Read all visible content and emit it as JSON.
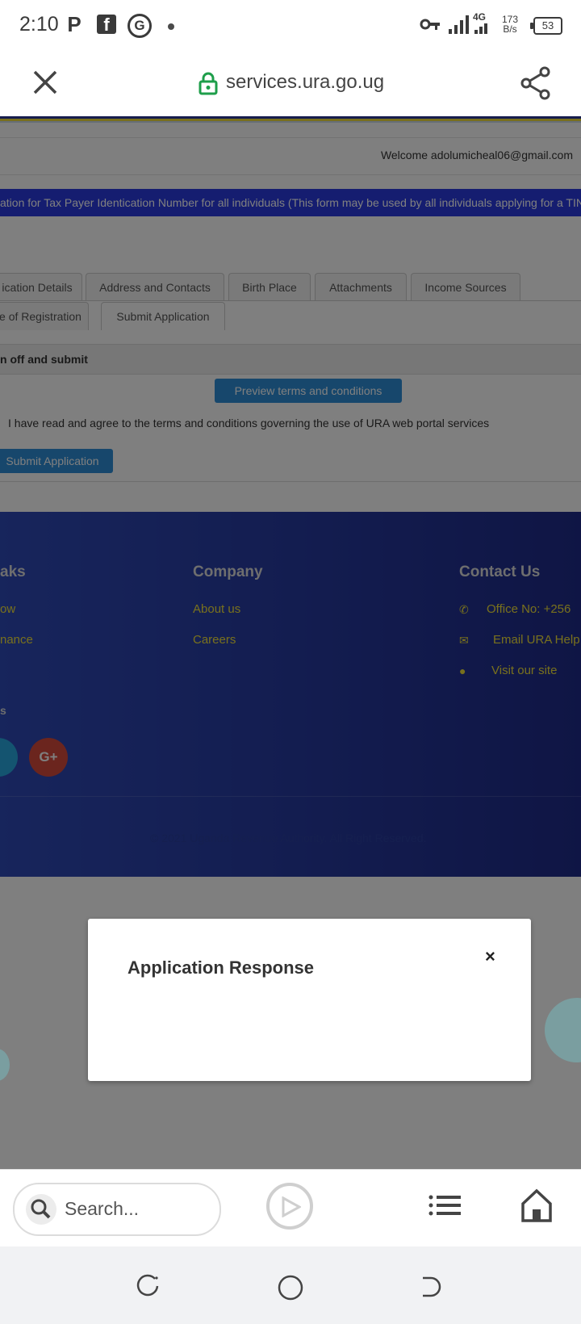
{
  "status_bar": {
    "time": "2:10",
    "notification_icons": [
      "parking-p-icon",
      "facebook-icon",
      "grammarly-icon",
      "dot-icon"
    ],
    "network": "4G",
    "speed_value": "173",
    "speed_unit": "B/s",
    "battery": "53"
  },
  "browser": {
    "url": "services.ura.go.ug"
  },
  "page": {
    "welcome": "Welcome adolumicheal06@gmail.com",
    "banner": "ation for Tax Payer Identication Number for all individuals (This form may be used by all individuals applying for a TIN",
    "tabs_row1": [
      "ication Details",
      "Address and Contacts",
      "Birth Place",
      "Attachments",
      "Income Sources"
    ],
    "tabs_row2": [
      "e of Registration",
      "Submit Application"
    ],
    "active_tab": "Submit Application",
    "section_header": "n off and submit",
    "preview_button": "Preview terms and conditions",
    "agree_text": "I have read and agree to the terms and conditions governing the use of URA web portal services",
    "submit_button": "Submit Application"
  },
  "footer": {
    "links_heading": "aks",
    "links": [
      "ow",
      "nance"
    ],
    "social_heading": "s",
    "company_heading": "Company",
    "company_links": [
      "About us",
      "Careers"
    ],
    "contact_heading": "Contact Us",
    "contact_items": [
      {
        "icon": "phone-icon",
        "text": "Office No: +256"
      },
      {
        "icon": "envelope-icon",
        "text": "Email URA Help"
      },
      {
        "icon": "globe-icon",
        "text": "Visit our site"
      }
    ],
    "gplus_label": "G+",
    "copyright": "© 2021 Uganda Revenue Authority. All Right Reserved."
  },
  "modal": {
    "title": "Application Response",
    "close": "×"
  },
  "toolbar": {
    "search_placeholder": "Search..."
  }
}
